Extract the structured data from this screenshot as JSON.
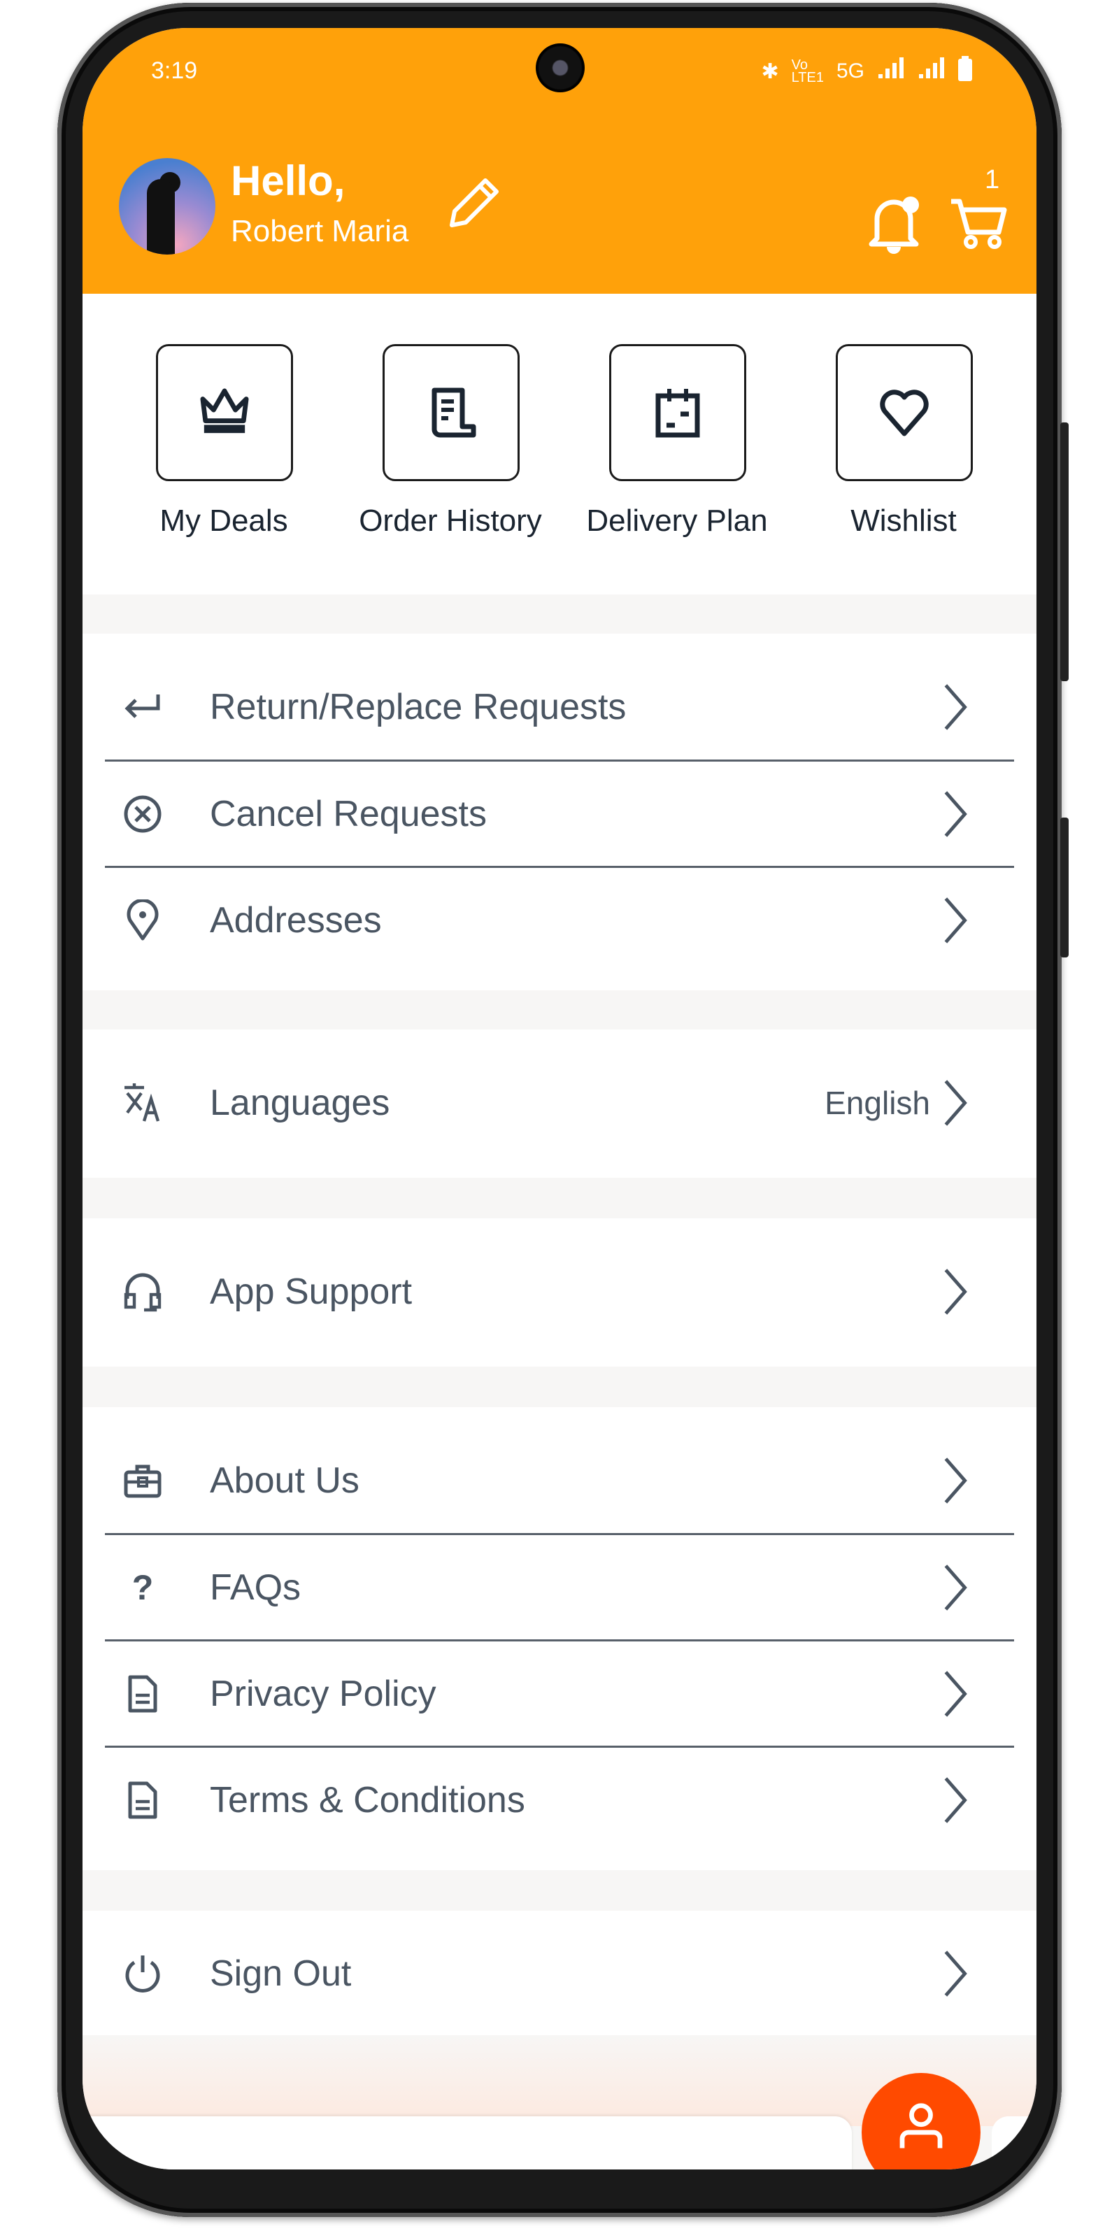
{
  "status_bar": {
    "time": "3:19",
    "network": "5G",
    "volte": "VoLTE1"
  },
  "header": {
    "greeting": "Hello,",
    "user_name": "Robert Maria",
    "cart_count": "1",
    "accent_color": "#ffa10a"
  },
  "quick_actions": [
    {
      "label": "My Deals",
      "icon": "crown-icon"
    },
    {
      "label": "Order History",
      "icon": "receipt-icon"
    },
    {
      "label": "Delivery Plan",
      "icon": "calendar-icon"
    },
    {
      "label": "Wishlist",
      "icon": "heart-icon"
    }
  ],
  "menu": {
    "requests": [
      {
        "label": "Return/Replace Requests",
        "icon": "return-arrow-icon"
      },
      {
        "label": "Cancel Requests",
        "icon": "cancel-circle-icon"
      },
      {
        "label": "Addresses",
        "icon": "location-pin-icon"
      }
    ],
    "languages": {
      "label": "Languages",
      "value": "English",
      "icon": "translate-icon"
    },
    "support": {
      "label": "App Support",
      "icon": "headset-icon"
    },
    "info": [
      {
        "label": "About Us",
        "icon": "briefcase-icon"
      },
      {
        "label": "FAQs",
        "icon": "question-icon"
      },
      {
        "label": "Privacy Policy",
        "icon": "document-icon"
      },
      {
        "label": "Terms & Conditions",
        "icon": "document-icon"
      }
    ],
    "sign_out": {
      "label": "Sign Out",
      "icon": "power-icon"
    }
  },
  "fab": {
    "icon": "user-icon",
    "color": "#ff4a00"
  }
}
